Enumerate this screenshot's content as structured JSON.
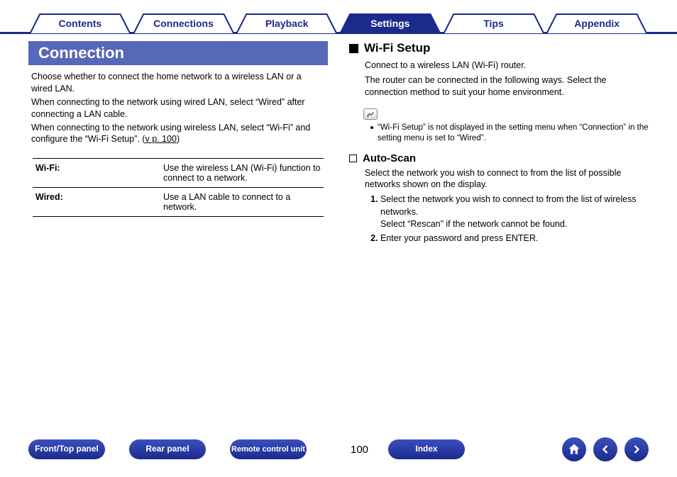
{
  "tabs": {
    "contents": "Contents",
    "connections": "Connections",
    "playback": "Playback",
    "settings": "Settings",
    "tips": "Tips",
    "appendix": "Appendix",
    "active": "settings"
  },
  "left": {
    "title": "Connection",
    "p1": "Choose whether to connect the home network to a wireless LAN or a wired LAN.",
    "p2": "When connecting to the network using wired LAN, select “Wired” after connecting a LAN cable.",
    "p3a": "When connecting to the network using wireless LAN, select “Wi-Fi” and configure the “Wi-Fi Setup”.  (",
    "p3link": "v p. 100",
    "p3b": ")",
    "rows": [
      {
        "label": "Wi-Fi:",
        "value": "Use the wireless LAN (Wi-Fi) function to connect to a network."
      },
      {
        "label": "Wired:",
        "value": "Use a LAN cable to connect to a network."
      }
    ]
  },
  "right": {
    "h2": "Wi-Fi Setup",
    "r1": "Connect to a wireless LAN (Wi-Fi) router.",
    "r2": "The router can be connected in the following ways. Select the connection method to suit your home environment.",
    "note": "“Wi-Fi Setup” is not displayed in the setting menu when “Connection” in the setting menu is set to “Wired”.",
    "h3": "Auto-Scan",
    "as1": "Select the network you wish to connect to from the list of possible networks shown on the display.",
    "steps": [
      "Select the network you wish to connect to from the list of wireless networks.\nSelect “Rescan” if the network cannot be found.",
      "Enter your password and press ENTER."
    ]
  },
  "footer": {
    "front": "Front/Top panel",
    "rear": "Rear panel",
    "remote": "Remote control unit",
    "page": "100",
    "index": "Index"
  }
}
